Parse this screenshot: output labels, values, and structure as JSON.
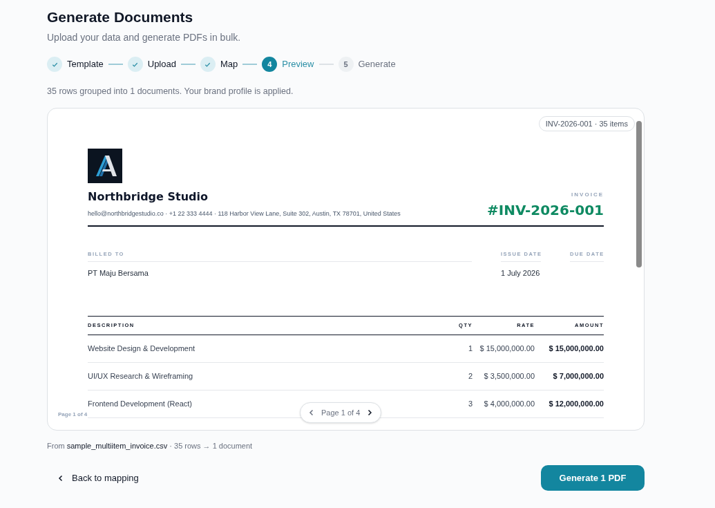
{
  "header": {
    "title": "Generate Documents",
    "subtitle": "Upload your data and generate PDFs in bulk."
  },
  "steps": [
    {
      "label": "Template",
      "kind": "done"
    },
    {
      "label": "Upload",
      "kind": "done"
    },
    {
      "label": "Map",
      "kind": "done"
    },
    {
      "number": "4",
      "label": "Preview",
      "kind": "current"
    },
    {
      "number": "5",
      "label": "Generate",
      "kind": "pending"
    }
  ],
  "summary": "35 rows grouped into 1 documents. Your brand profile is applied.",
  "preview": {
    "badge": "INV-2026-001 · 35 items",
    "page_label": "Page 1 of 4",
    "pager": "Page 1 of 4",
    "invoice": {
      "company": "Northbridge Studio",
      "contact": "hello@northbridgestudio.co · +1 22 333 4444 · 118 Harbor View Lane, Suite 302, Austin, TX 78701, United States",
      "doc_label": "INVOICE",
      "number": "#INV-2026-001",
      "billed_to_label": "BILLED TO",
      "billed_to": "PT Maju Bersama",
      "issue_date_label": "ISSUE DATE",
      "issue_date": "1 July 2026",
      "due_date_label": "DUE DATE",
      "columns": [
        "DESCRIPTION",
        "QTY",
        "RATE",
        "AMOUNT"
      ],
      "rows": [
        {
          "description": "Website Design & Development",
          "qty": "1",
          "rate": "$ 15,000,000.00",
          "amount": "$ 15,000,000.00"
        },
        {
          "description": "UI/UX Research & Wireframing",
          "qty": "2",
          "rate": "$ 3,500,000.00",
          "amount": "$ 7,000,000.00"
        },
        {
          "description": "Frontend Development (React)",
          "qty": "3",
          "rate": "$ 4,000,000.00",
          "amount": "$ 12,000,000.00"
        }
      ]
    }
  },
  "source": {
    "prefix": "From",
    "file": "sample_multiitem_invoice.csv",
    "suffix": "· 35 rows → 1 document"
  },
  "back_button": "Back to mapping",
  "generate_button": "Generate 1 PDF"
}
